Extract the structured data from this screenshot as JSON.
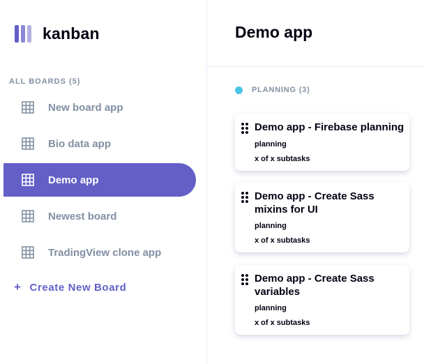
{
  "logo": {
    "text": "kanban",
    "color": "#635fc7"
  },
  "sidebar": {
    "heading": "ALL BOARDS (5)",
    "items": [
      {
        "label": "New board app",
        "icon": "board-grid-icon",
        "active": false
      },
      {
        "label": "Bio data app",
        "icon": "board-grid-icon",
        "active": false
      },
      {
        "label": "Demo app",
        "icon": "board-grid-icon",
        "active": true
      },
      {
        "label": "Newest board",
        "icon": "board-grid-icon",
        "active": false
      },
      {
        "label": "TradingView clone app",
        "icon": "board-grid-icon",
        "active": false
      }
    ],
    "create_label": "+ Create New Board",
    "create_text": "Create New Board",
    "create_icon": "plus-icon"
  },
  "header": {
    "title": "Demo app"
  },
  "column": {
    "title": "PLANNING (3)",
    "dot_color": "#49c4e5",
    "cards": [
      {
        "title_lines": [
          "Demo app - Firebase planning"
        ],
        "status": "planning",
        "subtasks": "x of x subtasks",
        "icon": "drag-handle-icon"
      },
      {
        "title_lines": [
          "Demo app - Create Sass",
          "mixins for UI"
        ],
        "status": "planning",
        "subtasks": "x of x subtasks",
        "icon": "drag-handle-icon"
      },
      {
        "title_lines": [
          "Demo app - Create Sass",
          "variables"
        ],
        "status": "planning",
        "subtasks": "x of x subtasks",
        "icon": "drag-handle-icon"
      }
    ]
  },
  "colors": {
    "accent": "#635fc7",
    "text": "#000112",
    "muted": "#828fa3",
    "border": "#e4ebfa"
  }
}
